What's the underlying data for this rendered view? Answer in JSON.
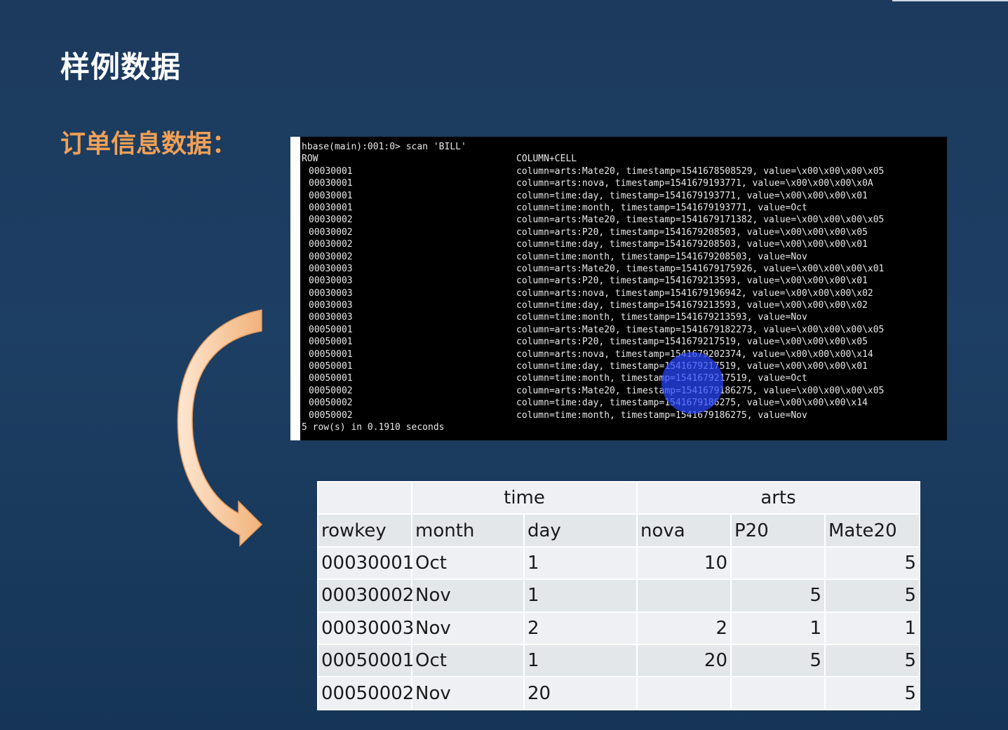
{
  "slide": {
    "title": "样例数据",
    "section_label": "订单信息数据："
  },
  "terminal": {
    "command": "hbase(main):001:0> scan 'BILL'",
    "header_row": "ROW",
    "header_cell": "COLUMN+CELL",
    "rows": [
      {
        "row": "00030001",
        "cell": "column=arts:Mate20, timestamp=1541678508529, value=\\x00\\x00\\x00\\x05"
      },
      {
        "row": "00030001",
        "cell": "column=arts:nova, timestamp=1541679193771, value=\\x00\\x00\\x00\\x0A"
      },
      {
        "row": "00030001",
        "cell": "column=time:day, timestamp=1541679193771, value=\\x00\\x00\\x00\\x01"
      },
      {
        "row": "00030001",
        "cell": "column=time:month, timestamp=1541679193771, value=Oct"
      },
      {
        "row": "00030002",
        "cell": "column=arts:Mate20, timestamp=1541679171382, value=\\x00\\x00\\x00\\x05"
      },
      {
        "row": "00030002",
        "cell": "column=arts:P20, timestamp=1541679208503, value=\\x00\\x00\\x00\\x05"
      },
      {
        "row": "00030002",
        "cell": "column=time:day, timestamp=1541679208503, value=\\x00\\x00\\x00\\x01"
      },
      {
        "row": "00030002",
        "cell": "column=time:month, timestamp=1541679208503, value=Nov"
      },
      {
        "row": "00030003",
        "cell": "column=arts:Mate20, timestamp=1541679175926, value=\\x00\\x00\\x00\\x01"
      },
      {
        "row": "00030003",
        "cell": "column=arts:P20, timestamp=1541679213593, value=\\x00\\x00\\x00\\x01"
      },
      {
        "row": "00030003",
        "cell": "column=arts:nova, timestamp=1541679196942, value=\\x00\\x00\\x00\\x02"
      },
      {
        "row": "00030003",
        "cell": "column=time:day, timestamp=1541679213593, value=\\x00\\x00\\x00\\x02"
      },
      {
        "row": "00030003",
        "cell": "column=time:month, timestamp=1541679213593, value=Nov"
      },
      {
        "row": "00050001",
        "cell": "column=arts:Mate20, timestamp=1541679182273, value=\\x00\\x00\\x00\\x05"
      },
      {
        "row": "00050001",
        "cell": "column=arts:P20, timestamp=1541679217519, value=\\x00\\x00\\x00\\x05"
      },
      {
        "row": "00050001",
        "cell": "column=arts:nova, timestamp=1541679202374, value=\\x00\\x00\\x00\\x14"
      },
      {
        "row": "00050001",
        "cell": "column=time:day, timestamp=1541679217519, value=\\x00\\x00\\x00\\x01"
      },
      {
        "row": "00050001",
        "cell": "column=time:month, timestamp=1541679217519, value=Oct"
      },
      {
        "row": "00050002",
        "cell": "column=arts:Mate20, timestamp=1541679186275, value=\\x00\\x00\\x00\\x05"
      },
      {
        "row": "00050002",
        "cell": "column=time:day, timestamp=1541679186275, value=\\x00\\x00\\x00\\x14"
      },
      {
        "row": "00050002",
        "cell": "column=time:month, timestamp=1541679186275, value=Nov"
      }
    ],
    "footer": "5 row(s) in 0.1910 seconds"
  },
  "table": {
    "group_headers": {
      "time": "time",
      "arts": "arts"
    },
    "columns": [
      "rowkey",
      "month",
      "day",
      "nova",
      "P20",
      "Mate20"
    ],
    "rows": [
      [
        "00030001",
        "Oct",
        "1",
        "10",
        "",
        "5"
      ],
      [
        "00030002",
        "Nov",
        "1",
        "",
        "5",
        "5"
      ],
      [
        "00030003",
        "Nov",
        "2",
        "2",
        "1",
        "1"
      ],
      [
        "00050001",
        "Oct",
        "1",
        "20",
        "5",
        "5"
      ],
      [
        "00050002",
        "Nov",
        "20",
        "",
        "",
        "5"
      ]
    ]
  },
  "colors": {
    "background": "#1c3a5e",
    "title": "#ffffff",
    "section_label": "#f0a055",
    "terminal_bg": "#000000",
    "arrow": "#f7c89a",
    "cursor": "#2846ff"
  }
}
